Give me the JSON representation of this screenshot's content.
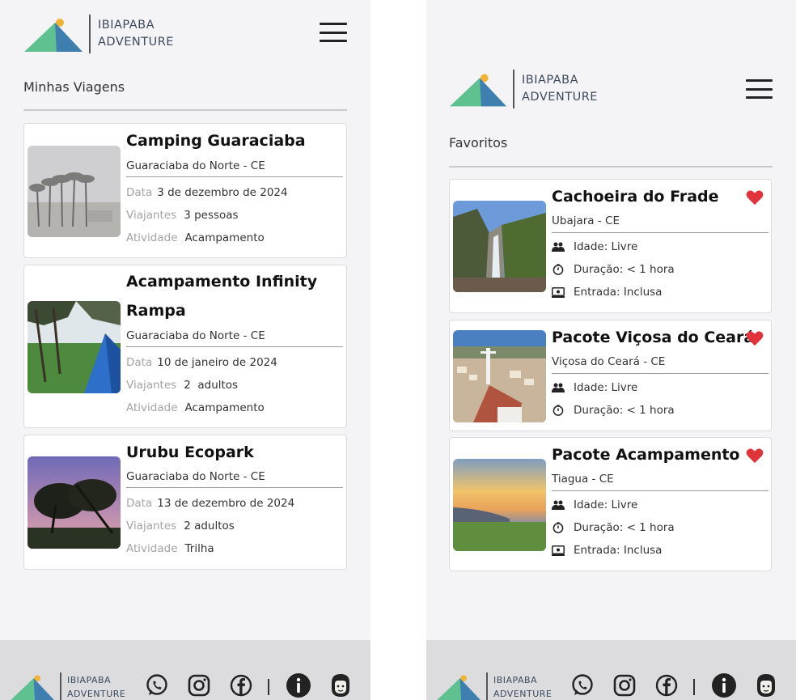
{
  "brand": {
    "line1": "IBIAPABA",
    "line2": "ADVENTURE"
  },
  "colors": {
    "background": "#f4f3f5",
    "footer": "#dcdcdf",
    "heart": "#e0333a",
    "mountain_left": "#5ec18f",
    "mountain_right": "#3f7fb0",
    "sun": "#f2b233"
  },
  "trips": {
    "title": "Minhas Viagens",
    "items": [
      {
        "title": "Camping Guaraciaba",
        "location": "Guaraciaba do Norte - CE",
        "date_label": "Data",
        "date": "3 de dezembro de 2024",
        "travelers_label": "Viajantes",
        "travelers": "3 pessoas",
        "activity_label": "Atividade",
        "activity": "Acampamento"
      },
      {
        "title_line1": "Acampamento Infinity",
        "title_line2": "Rampa",
        "location": "Guaraciaba do Norte - CE",
        "date_label": "Data",
        "date": "10 de janeiro de 2024",
        "travelers_label": "Viajantes",
        "travelers": "2  adultos",
        "activity_label": "Atividade",
        "activity": "Acampamento"
      },
      {
        "title": "Urubu Ecopark",
        "location": "Guaraciaba do Norte - CE",
        "date_label": "Data",
        "date": "13 de dezembro de 2024",
        "travelers_label": "Viajantes",
        "travelers": "2 adultos",
        "activity_label": "Atividade",
        "activity": "Trilha"
      }
    ]
  },
  "favorites": {
    "title": "Favoritos",
    "items": [
      {
        "title": "Cachoeira do Frade",
        "location": "Ubajara - CE",
        "age": "Idade: Livre",
        "duration": "Duração: < 1 hora",
        "entry": "Entrada: Inclusa"
      },
      {
        "title": "Pacote Viçosa do Ceará",
        "location": "Viçosa do Ceará - CE",
        "age": "Idade: Livre",
        "duration": "Duração: < 1 hora"
      },
      {
        "title": "Pacote Acampamento",
        "location": "Tiagua - CE",
        "age": "Idade: Livre",
        "duration": "Duração: < 1 hora",
        "entry": "Entrada: Inclusa"
      }
    ]
  },
  "footer_icons": [
    "whatsapp-icon",
    "instagram-icon",
    "facebook-icon",
    "info-icon",
    "profile-icon"
  ]
}
